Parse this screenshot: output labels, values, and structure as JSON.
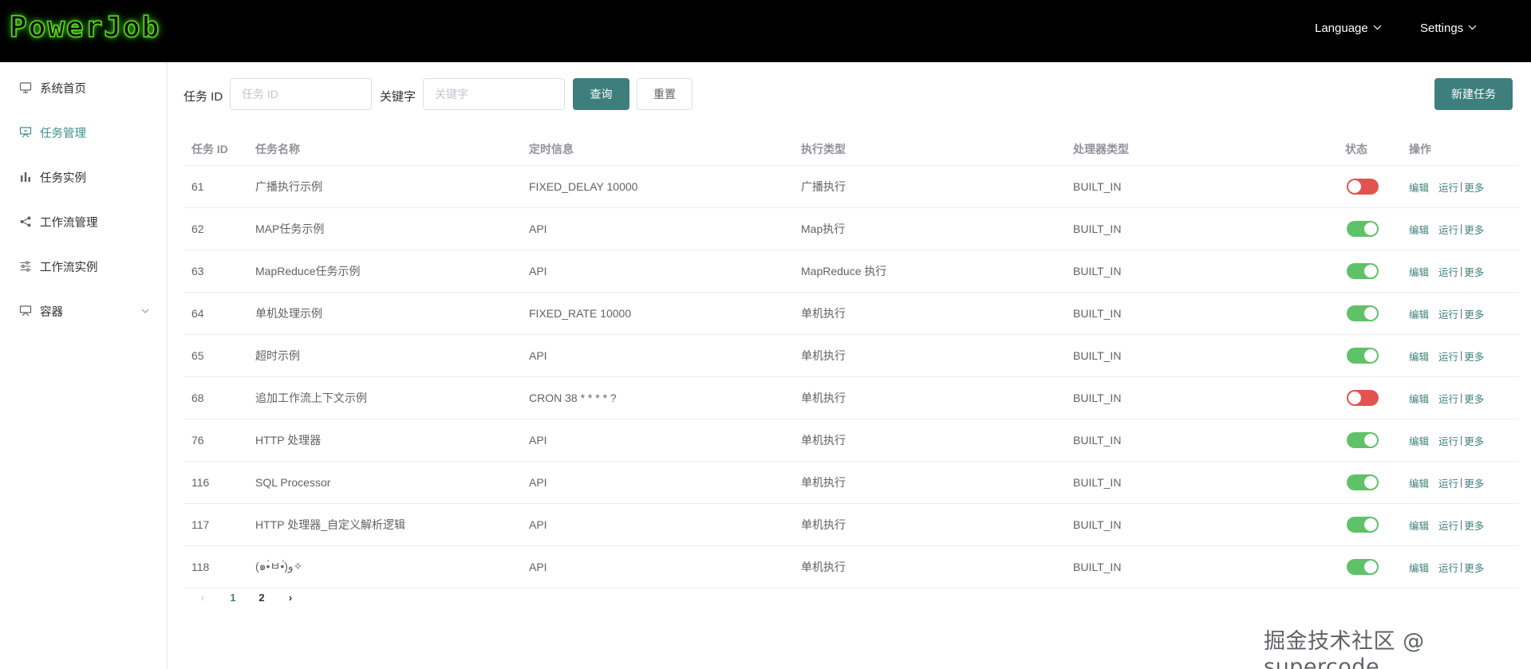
{
  "header": {
    "logo": "PowerJob",
    "nav": [
      {
        "label": "Language"
      },
      {
        "label": "Settings"
      }
    ]
  },
  "sidebar": {
    "items": [
      {
        "label": "系统首页",
        "icon": "monitor-icon"
      },
      {
        "label": "任务管理",
        "icon": "presentation-board-icon",
        "active": true
      },
      {
        "label": "任务实例",
        "icon": "bar-chart-icon"
      },
      {
        "label": "工作流管理",
        "icon": "share-nodes-icon"
      },
      {
        "label": "工作流实例",
        "icon": "sliders-icon"
      },
      {
        "label": "容器",
        "icon": "container-board-icon",
        "expandable": true
      }
    ]
  },
  "filters": {
    "job_id_label": "任务 ID",
    "job_id_placeholder": "任务 ID",
    "keyword_label": "关键字",
    "keyword_placeholder": "关键字",
    "query_button": "查询",
    "reset_button": "重置",
    "new_job_button": "新建任务"
  },
  "table": {
    "columns": [
      "任务 ID",
      "任务名称",
      "定时信息",
      "执行类型",
      "处理器类型",
      "状态",
      "操作"
    ],
    "rows": [
      {
        "id": "61",
        "name": "广播执行示例",
        "timing": "FIXED_DELAY 10000",
        "exec_type": "广播执行",
        "processor": "BUILT_IN",
        "enabled": false
      },
      {
        "id": "62",
        "name": "MAP任务示例",
        "timing": "API",
        "exec_type": "Map执行",
        "processor": "BUILT_IN",
        "enabled": true
      },
      {
        "id": "63",
        "name": "MapReduce任务示例",
        "timing": "API",
        "exec_type": "MapReduce 执行",
        "processor": "BUILT_IN",
        "enabled": true
      },
      {
        "id": "64",
        "name": "单机处理示例",
        "timing": "FIXED_RATE 10000",
        "exec_type": "单机执行",
        "processor": "BUILT_IN",
        "enabled": true
      },
      {
        "id": "65",
        "name": "超时示例",
        "timing": "API",
        "exec_type": "单机执行",
        "processor": "BUILT_IN",
        "enabled": true
      },
      {
        "id": "68",
        "name": "追加工作流上下文示例",
        "timing": "CRON 38 * * * * ?",
        "exec_type": "单机执行",
        "processor": "BUILT_IN",
        "enabled": false
      },
      {
        "id": "76",
        "name": "HTTP 处理器",
        "timing": "API",
        "exec_type": "单机执行",
        "processor": "BUILT_IN",
        "enabled": true
      },
      {
        "id": "116",
        "name": "SQL Processor",
        "timing": "API",
        "exec_type": "单机执行",
        "processor": "BUILT_IN",
        "enabled": true
      },
      {
        "id": "117",
        "name": "HTTP 处理器_自定义解析逻辑",
        "timing": "API",
        "exec_type": "单机执行",
        "processor": "BUILT_IN",
        "enabled": true
      },
      {
        "id": "118",
        "name": "(๑•̀ㅂ•́)و✧",
        "timing": "API",
        "exec_type": "单机执行",
        "processor": "BUILT_IN",
        "enabled": true
      }
    ],
    "actions": {
      "edit": "编辑",
      "run": "运行",
      "more": "更多",
      "separator": "|"
    }
  },
  "pagination": {
    "prev": "‹",
    "pages": [
      "1",
      "2"
    ],
    "current": "1",
    "next": "›"
  },
  "colors": {
    "primary": "#3e7f7d",
    "switch_on": "#5fc268",
    "switch_off": "#e2534f",
    "logo_glow": "#58e01f"
  },
  "watermark": "掘金技术社区 @ supercode"
}
